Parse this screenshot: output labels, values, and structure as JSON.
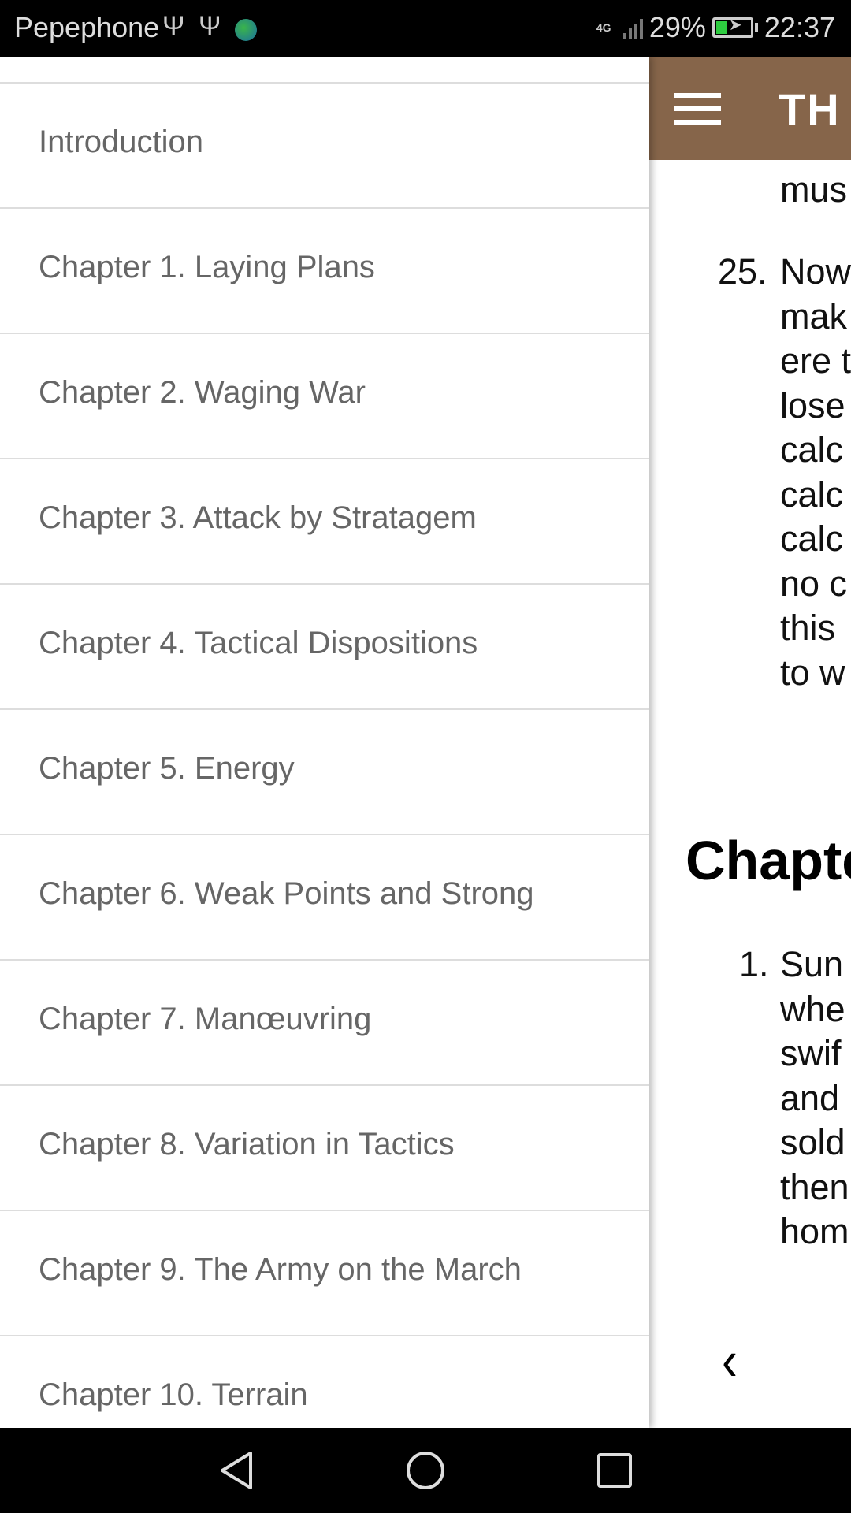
{
  "status_bar": {
    "carrier": "Pepephone",
    "network": "4G",
    "battery": "29%",
    "battery_level": 0.29,
    "time": "22:37",
    "icons": [
      "usb-icon",
      "usb-icon",
      "globe-app-icon",
      "signal-icon",
      "battery-charging-icon"
    ]
  },
  "drawer": {
    "items": [
      {
        "label": "Introduction"
      },
      {
        "label": "Chapter 1. Laying Plans"
      },
      {
        "label": "Chapter 2. Waging War"
      },
      {
        "label": "Chapter 3. Attack by Stratagem"
      },
      {
        "label": "Chapter 4. Tactical Dispositions"
      },
      {
        "label": "Chapter 5. Energy"
      },
      {
        "label": "Chapter 6. Weak Points and Strong"
      },
      {
        "label": "Chapter 7. Manœuvring"
      },
      {
        "label": "Chapter 8. Variation in Tactics"
      },
      {
        "label": "Chapter 9. The Army on the March"
      },
      {
        "label": "Chapter 10. Terrain"
      }
    ]
  },
  "content": {
    "appbar_title": "TH",
    "text_top": "mus",
    "item25_number": "25.",
    "item25_lines": [
      "Now",
      "mak",
      "ere t",
      "lose",
      "calc",
      "calc",
      "calc",
      "no c",
      "this",
      "to w"
    ],
    "chapter_heading": "Chapte",
    "item1_number": "1.",
    "item1_lines": [
      "Sun",
      "whe",
      "swif",
      "and",
      "sold",
      "then",
      "hom"
    ],
    "header_color": "#86654a"
  }
}
